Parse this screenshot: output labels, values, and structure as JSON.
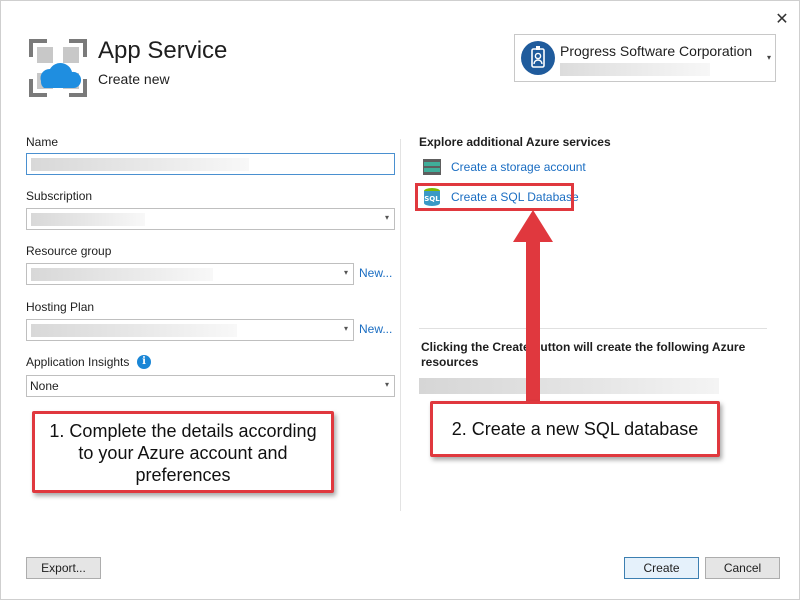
{
  "dialog": {
    "title": "App Service",
    "subtitle": "Create new",
    "close_glyph": "✕"
  },
  "account": {
    "name": "Progress Software Corporation",
    "icon": "account-badge-icon"
  },
  "form": {
    "name_label": "Name",
    "subscription_label": "Subscription",
    "resource_group_label": "Resource group",
    "resource_group_new": "New...",
    "hosting_plan_label": "Hosting Plan",
    "hosting_plan_new": "New...",
    "app_insights_label": "Application Insights",
    "app_insights_value": "None",
    "info_glyph": "i"
  },
  "services": {
    "heading": "Explore additional Azure services",
    "items": [
      {
        "label": "Create a storage account",
        "icon": "storage-account-icon"
      },
      {
        "label": "Create a SQL Database",
        "icon": "sql-database-icon"
      }
    ]
  },
  "summary": {
    "text": "Clicking the Create button will create the following Azure resources"
  },
  "annotations": {
    "callout1": "1. Complete the details according to your Azure account and preferences",
    "callout2": "2. Create a new SQL database",
    "color": "#e0383e"
  },
  "buttons": {
    "export": "Export...",
    "create": "Create",
    "cancel": "Cancel"
  },
  "colors": {
    "link": "#1a6dc2",
    "accent": "#1a86d6",
    "annotation_red": "#e0383e"
  }
}
